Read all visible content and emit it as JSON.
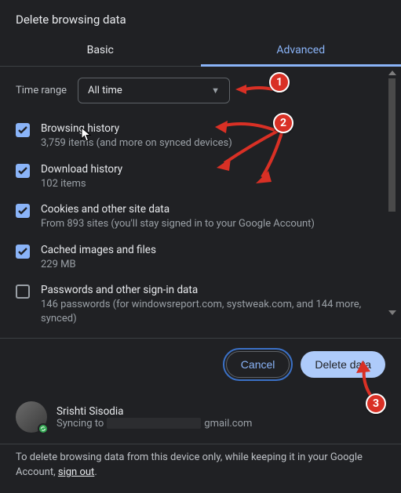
{
  "title": "Delete browsing data",
  "tabs": {
    "basic": "Basic",
    "advanced": "Advanced"
  },
  "timeRange": {
    "label": "Time range",
    "value": "All time"
  },
  "options": [
    {
      "title": "Browsing history",
      "sub": "3,759 items (and more on synced devices)",
      "checked": true
    },
    {
      "title": "Download history",
      "sub": "102 items",
      "checked": true
    },
    {
      "title": "Cookies and other site data",
      "sub": "From 893 sites (you'll stay signed in to your Google Account)",
      "checked": true
    },
    {
      "title": "Cached images and files",
      "sub": "229 MB",
      "checked": true
    },
    {
      "title": "Passwords and other sign-in data",
      "sub": "146 passwords (for windowsreport.com, systweak.com, and 144 more, synced)",
      "checked": false
    }
  ],
  "actions": {
    "cancel": "Cancel",
    "delete": "Delete data"
  },
  "account": {
    "name": "Srishti Sisodia",
    "syncPrefix": "Syncing to",
    "emailSuffix": "gmail.com"
  },
  "footer": {
    "text1": "To delete browsing data from this device only, while keeping it in your Google Account, ",
    "link": "sign out",
    "text2": "."
  },
  "annotations": {
    "b1": "1",
    "b2": "2",
    "b3": "3"
  }
}
